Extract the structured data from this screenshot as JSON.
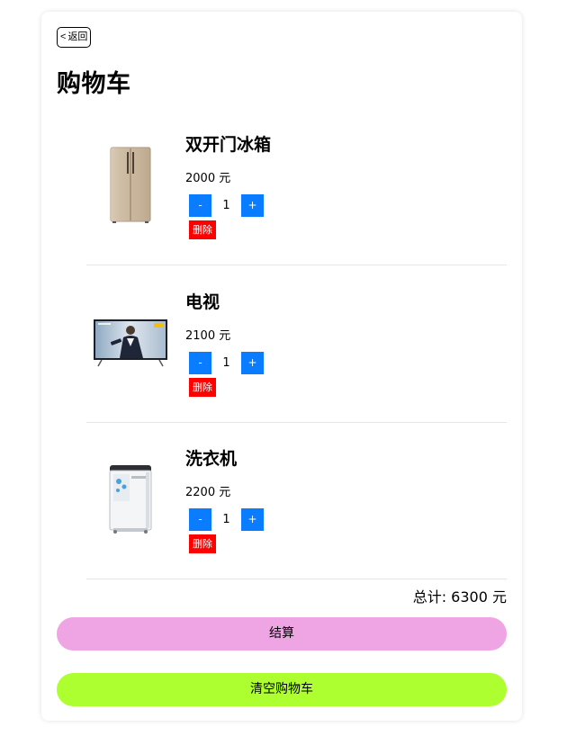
{
  "back_button": {
    "icon": "chevron-left",
    "label": "返回"
  },
  "page_title": "购物车",
  "items": [
    {
      "name": "双开门冰箱",
      "price": "2000 元",
      "quantity": "1",
      "image": "refrigerator"
    },
    {
      "name": "电视",
      "price": "2100 元",
      "quantity": "1",
      "image": "television"
    },
    {
      "name": "洗衣机",
      "price": "2200 元",
      "quantity": "1",
      "image": "washing-machine"
    }
  ],
  "controls": {
    "decrease_label": "-",
    "increase_label": "+",
    "delete_label": "删除"
  },
  "total": "总计: 6300 元",
  "checkout_label": "结算",
  "clear_label": "清空购物车",
  "colors": {
    "qty_button": "#0a7cff",
    "delete_button": "#ff0000",
    "checkout_button": "#efa4e4",
    "clear_button": "#adff2f"
  }
}
